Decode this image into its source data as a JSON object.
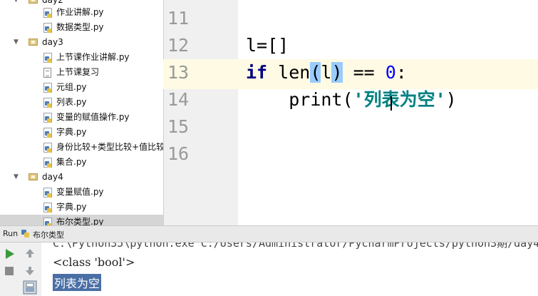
{
  "project_tree": {
    "items": [
      {
        "label": "day2",
        "type": "folder"
      },
      {
        "label": "作业讲解.py",
        "type": "py"
      },
      {
        "label": "数据类型.py",
        "type": "py"
      },
      {
        "label": "day3",
        "type": "folder"
      },
      {
        "label": "上节课作业讲解.py",
        "type": "py"
      },
      {
        "label": "上节课复习",
        "type": "txt"
      },
      {
        "label": "元组.py",
        "type": "py"
      },
      {
        "label": "列表.py",
        "type": "py"
      },
      {
        "label": "变量的赋值操作.py",
        "type": "py"
      },
      {
        "label": "字典.py",
        "type": "py"
      },
      {
        "label": "身份比较+类型比较+值比较",
        "type": "py"
      },
      {
        "label": "集合.py",
        "type": "py"
      },
      {
        "label": "day4",
        "type": "folder"
      },
      {
        "label": "变量赋值.py",
        "type": "py"
      },
      {
        "label": "字典.py",
        "type": "py"
      },
      {
        "label": "布尔类型.py",
        "type": "py"
      }
    ]
  },
  "editor": {
    "line_numbers": [
      "11",
      "12",
      "13",
      "14",
      "15",
      "16"
    ],
    "line12": "l=[]",
    "line13": {
      "kw": "if",
      "fn": "len",
      "open": "(",
      "arg": "l",
      "close": ")",
      "op": " == ",
      "num": "0",
      "colon": ":"
    },
    "line14": {
      "indent": "    ",
      "fn": "print",
      "open": "(",
      "str": "'列表为空'",
      "close": ")"
    }
  },
  "run_bar": {
    "label": "Run",
    "file": "布尔类型"
  },
  "console": {
    "command": "C:\\Python35\\python.exe C:/Users/Administrator/PycharmProjects/python3期/day4",
    "output_lines": [
      "<class 'bool'>",
      "列表为空"
    ]
  },
  "toolbar": {
    "icons": [
      "run-icon",
      "up-arrow-icon",
      "stop-icon",
      "down-arrow-icon",
      "print-icon"
    ]
  }
}
